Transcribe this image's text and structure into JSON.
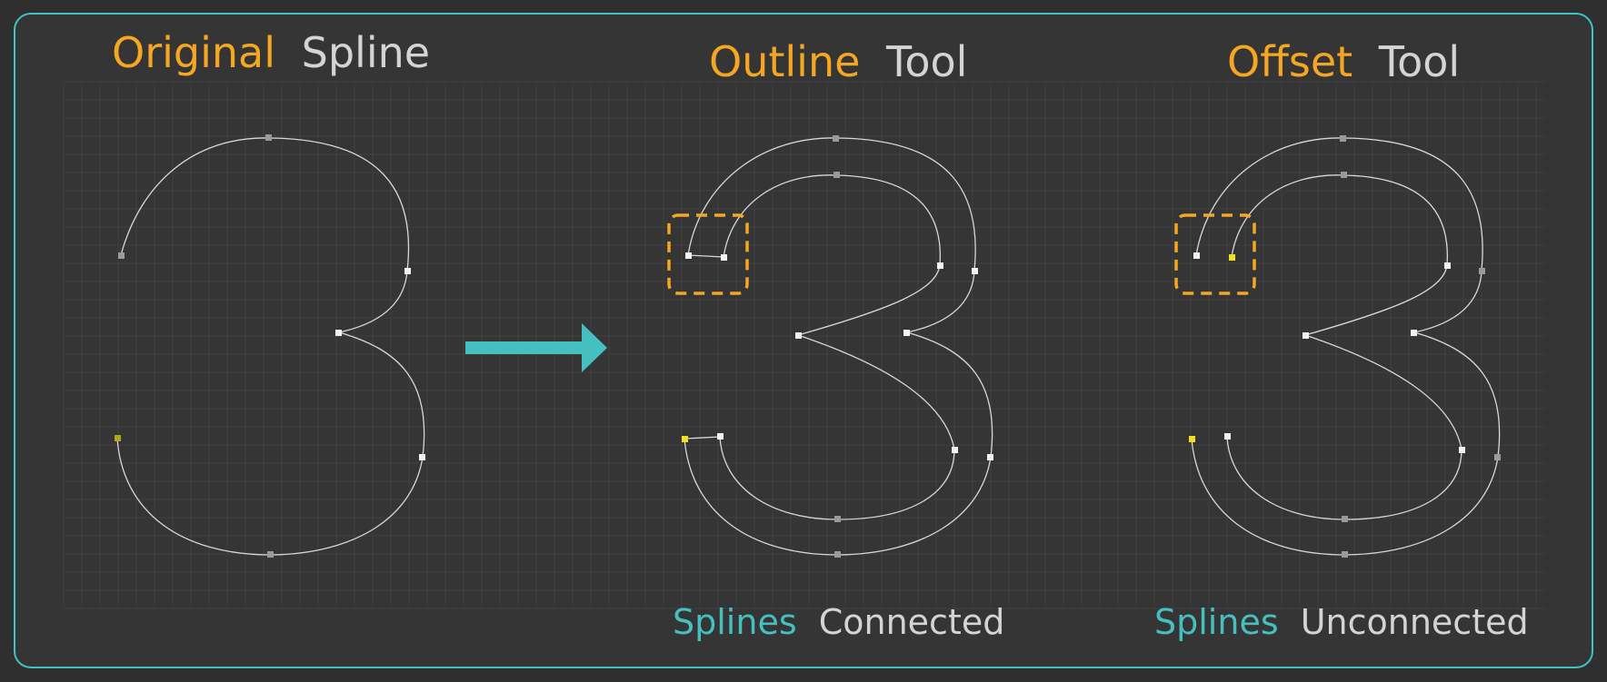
{
  "colors": {
    "background": "#353535",
    "frame": "#3fc4c4",
    "accent_orange": "#f5a623",
    "accent_teal": "#46bfc0",
    "curve": "#d8d8d8",
    "selected_point": "#f2e020"
  },
  "panels": [
    {
      "title_accent": "Original",
      "title_rest": "Spline",
      "caption_accent": "",
      "caption_rest": ""
    },
    {
      "title_accent": "Outline",
      "title_rest": "Tool",
      "caption_accent": "Splines",
      "caption_rest": "Connected"
    },
    {
      "title_accent": "Offset",
      "title_rest": "Tool",
      "caption_accent": "Splines",
      "caption_rest": "Unconnected"
    }
  ],
  "arrow": {
    "icon": "right-arrow-icon"
  }
}
